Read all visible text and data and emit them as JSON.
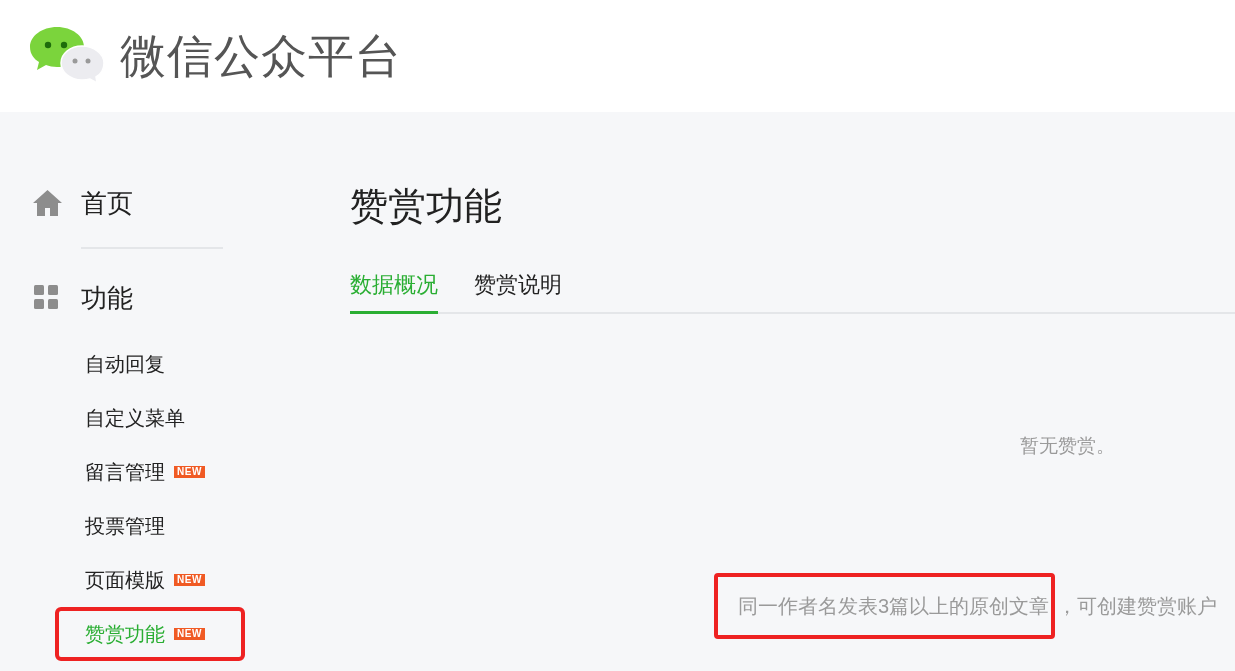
{
  "header": {
    "title": "微信公众平台"
  },
  "sidebar": {
    "home": {
      "label": "首页"
    },
    "section": {
      "label": "功能"
    },
    "items": [
      {
        "label": "自动回复",
        "selected": false,
        "highlighted": false
      },
      {
        "label": "自定义菜单",
        "selected": false,
        "highlighted": false
      },
      {
        "label": "留言管理",
        "badge": "NEW",
        "selected": false,
        "highlighted": false
      },
      {
        "label": "投票管理",
        "selected": false,
        "highlighted": false
      },
      {
        "label": "页面模版",
        "badge": "NEW",
        "selected": false,
        "highlighted": false
      },
      {
        "label": "赞赏功能",
        "badge": "NEW",
        "selected": true,
        "highlighted": true
      }
    ]
  },
  "main": {
    "title": "赞赏功能",
    "tabs": [
      {
        "label": "数据概况",
        "selected": true
      },
      {
        "label": "赞赏说明",
        "selected": false
      }
    ],
    "empty_message": "暂无赞赏。",
    "notice": {
      "highlighted_part": "同一作者名发表3篇以上的原创文章",
      "rest": "，可创建赞赏账户"
    }
  }
}
